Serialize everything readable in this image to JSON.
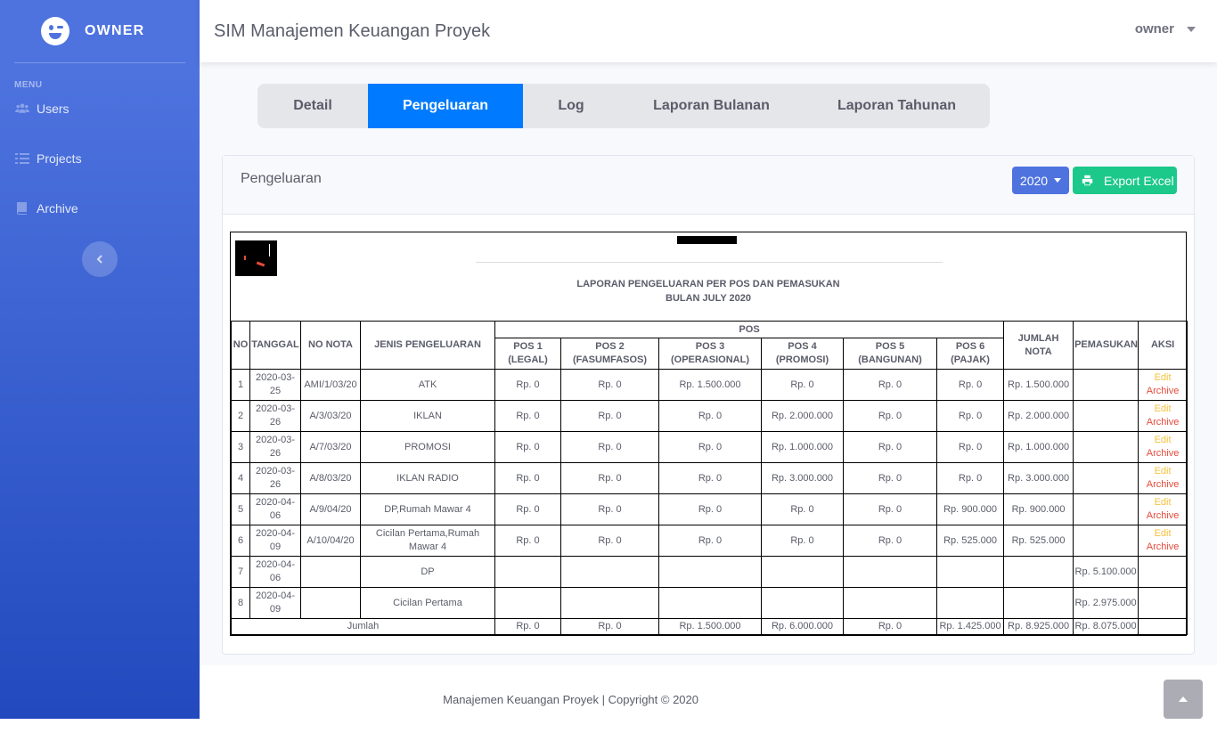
{
  "sidebar": {
    "brand": "OWNER",
    "heading": "MENU",
    "items": [
      {
        "label": "Users",
        "icon": "users-icon"
      },
      {
        "label": "Projects",
        "icon": "list-icon"
      },
      {
        "label": "Archive",
        "icon": "book-icon"
      }
    ]
  },
  "topbar": {
    "title": "SIM Manajemen Keuangan Proyek",
    "user": "owner"
  },
  "tabs": [
    "Detail",
    "Pengeluaran",
    "Log",
    "Laporan Bulanan",
    "Laporan Tahunan"
  ],
  "active_tab": "Pengeluaran",
  "card": {
    "title": "Pengeluaran",
    "year": "2020",
    "export_label": "Export Excel"
  },
  "report": {
    "title_line1": "LAPORAN PENGELUARAN PER POS DAN PEMASUKAN",
    "title_line2": "BULAN JULY 2020",
    "headers": {
      "no": "NO",
      "tanggal": "TANGGAL",
      "no_nota": "NO NOTA",
      "jenis": "JENIS PENGELUARAN",
      "pos": "POS",
      "jumlah_nota": "JUMLAH NOTA",
      "pemasukan": "PEMASUKAN",
      "aksi": "AKSI",
      "pos1": "POS 1 (LEGAL)",
      "pos2": "POS 2 (FASUMFASOS)",
      "pos3": "POS 3 (OPERASIONAL)",
      "pos4": "POS 4 (PROMOSI)",
      "pos5": "POS 5 (BANGUNAN)",
      "pos6": "POS 6 (PAJAK)"
    },
    "rows": [
      {
        "no": "1",
        "tanggal": "2020-03-25",
        "nota": "AMI/1/03/20",
        "jenis": "ATK",
        "pos1": "Rp. 0",
        "pos2": "Rp. 0",
        "pos3": "Rp. 1.500.000",
        "pos4": "Rp. 0",
        "pos5": "Rp. 0",
        "pos6": "Rp. 0",
        "jumlah": "Rp. 1.500.000",
        "pemasukan": "",
        "edit": "Edit",
        "archive": "Archive"
      },
      {
        "no": "2",
        "tanggal": "2020-03-26",
        "nota": "A/3/03/20",
        "jenis": "IKLAN",
        "pos1": "Rp. 0",
        "pos2": "Rp. 0",
        "pos3": "Rp. 0",
        "pos4": "Rp. 2.000.000",
        "pos5": "Rp. 0",
        "pos6": "Rp. 0",
        "jumlah": "Rp. 2.000.000",
        "pemasukan": "",
        "edit": "Edit",
        "archive": "Archive"
      },
      {
        "no": "3",
        "tanggal": "2020-03-26",
        "nota": "A/7/03/20",
        "jenis": "PROMOSI",
        "pos1": "Rp. 0",
        "pos2": "Rp. 0",
        "pos3": "Rp. 0",
        "pos4": "Rp. 1.000.000",
        "pos5": "Rp. 0",
        "pos6": "Rp. 0",
        "jumlah": "Rp. 1.000.000",
        "pemasukan": "",
        "edit": "Edit",
        "archive": "Archive"
      },
      {
        "no": "4",
        "tanggal": "2020-03-26",
        "nota": "A/8/03/20",
        "jenis": "IKLAN RADIO",
        "pos1": "Rp. 0",
        "pos2": "Rp. 0",
        "pos3": "Rp. 0",
        "pos4": "Rp. 3.000.000",
        "pos5": "Rp. 0",
        "pos6": "Rp. 0",
        "jumlah": "Rp. 3.000.000",
        "pemasukan": "",
        "edit": "Edit",
        "archive": "Archive"
      },
      {
        "no": "5",
        "tanggal": "2020-04-06",
        "nota": "A/9/04/20",
        "jenis": "DP,Rumah Mawar 4",
        "pos1": "Rp. 0",
        "pos2": "Rp. 0",
        "pos3": "Rp. 0",
        "pos4": "Rp. 0",
        "pos5": "Rp. 0",
        "pos6": "Rp. 900.000",
        "jumlah": "Rp. 900.000",
        "pemasukan": "",
        "edit": "Edit",
        "archive": "Archive"
      },
      {
        "no": "6",
        "tanggal": "2020-04-09",
        "nota": "A/10/04/20",
        "jenis": "Cicilan Pertama,Rumah Mawar 4",
        "pos1": "Rp. 0",
        "pos2": "Rp. 0",
        "pos3": "Rp. 0",
        "pos4": "Rp. 0",
        "pos5": "Rp. 0",
        "pos6": "Rp. 525.000",
        "jumlah": "Rp. 525.000",
        "pemasukan": "",
        "edit": "Edit",
        "archive": "Archive"
      },
      {
        "no": "7",
        "tanggal": "2020-04-06",
        "nota": "",
        "jenis": "DP",
        "pos1": "",
        "pos2": "",
        "pos3": "",
        "pos4": "",
        "pos5": "",
        "pos6": "",
        "jumlah": "",
        "pemasukan": "Rp. 5.100.000",
        "edit": "",
        "archive": ""
      },
      {
        "no": "8",
        "tanggal": "2020-04-09",
        "nota": "",
        "jenis": "Cicilan Pertama",
        "pos1": "",
        "pos2": "",
        "pos3": "",
        "pos4": "",
        "pos5": "",
        "pos6": "",
        "jumlah": "",
        "pemasukan": "Rp. 2.975.000",
        "edit": "",
        "archive": ""
      }
    ],
    "total": {
      "label": "Jumlah",
      "pos1": "Rp. 0",
      "pos2": "Rp. 0",
      "pos3": "Rp. 1.500.000",
      "pos4": "Rp. 6.000.000",
      "pos5": "Rp. 0",
      "pos6": "Rp. 1.425.000",
      "jumlah": "Rp. 8.925.000",
      "pemasukan": "Rp. 8.075.000"
    }
  },
  "footer": "Manajemen Keuangan Proyek | Copyright © 2020",
  "colors": {
    "primary": "#4e73df",
    "tab_active": "#007bff",
    "success": "#1cc88a",
    "warning": "#f6c23e",
    "danger": "#e74a3b"
  }
}
